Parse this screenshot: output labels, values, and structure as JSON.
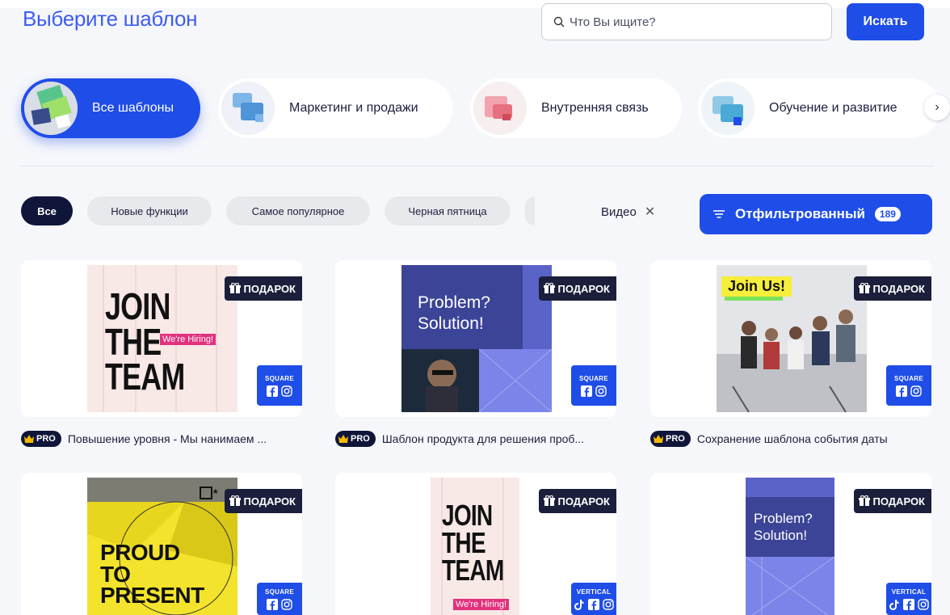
{
  "header": {
    "title": "Выберите шаблон",
    "search_placeholder": "Что Вы ищите?",
    "search_button": "Искать"
  },
  "categories": [
    {
      "label": "Все шаблоны",
      "active": true
    },
    {
      "label": "Маркетинг и продажи",
      "active": false
    },
    {
      "label": "Внутренняя связь",
      "active": false
    },
    {
      "label": "Обучение и развитие",
      "active": false
    }
  ],
  "chips": [
    "Все",
    "Новые функции",
    "Самое популярное",
    "Черная пятница"
  ],
  "active_filter": "Видео",
  "filter_button": {
    "label": "Отфильтрованный",
    "count": "189"
  },
  "gift_label": "ПОДАРОК",
  "pro_label": "PRO",
  "cards": [
    {
      "title": "Повышение уровня - Мы нанимаем ...",
      "format": "SQUARE",
      "lines": [
        "JOIN",
        "THE",
        "TEAM"
      ],
      "tag": "We're Hiring!"
    },
    {
      "title": "Шаблон продукта для решения проб...",
      "format": "SQUARE",
      "lines": [
        "Problem?",
        "Solution!"
      ]
    },
    {
      "title": "Сохранение шаблона события даты",
      "format": "SQUARE",
      "tag": "Join Us!"
    },
    {
      "format": "SQUARE",
      "lines": [
        "PROUD",
        "TO",
        "PRESENT"
      ]
    },
    {
      "format": "VERTICAL",
      "lines": [
        "JOIN",
        "THE",
        "TEAM"
      ],
      "tag": "We're Hiring!"
    },
    {
      "format": "VERTICAL",
      "lines": [
        "Problem?",
        "Solution!"
      ]
    }
  ],
  "colors": {
    "accent": "#1f4de8",
    "dark": "#10163a",
    "title": "#3d5df2",
    "pink": "#e2317d"
  }
}
